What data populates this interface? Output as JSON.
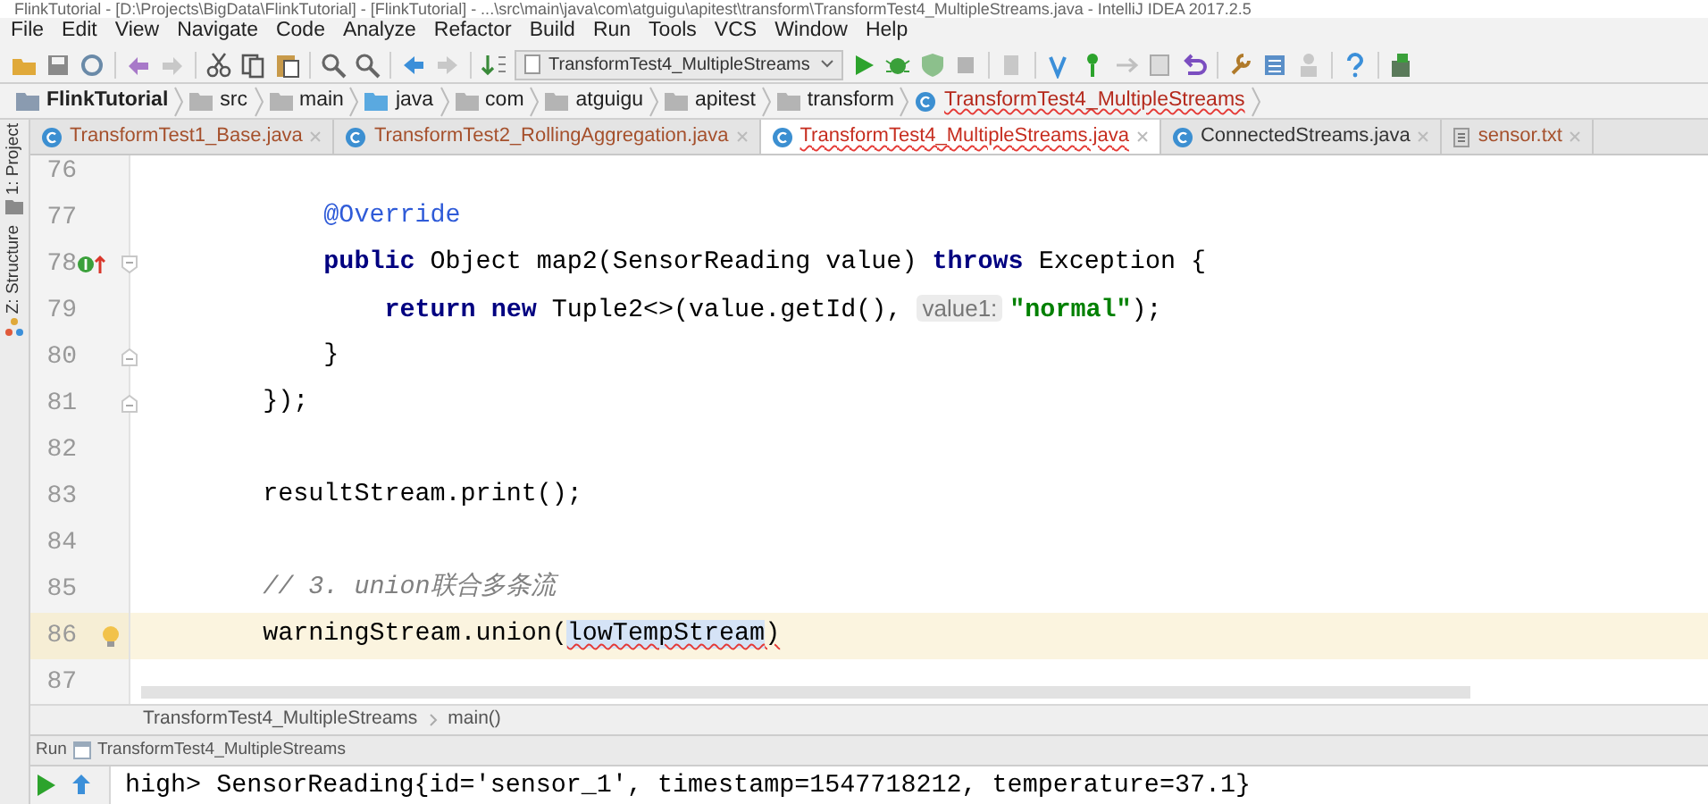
{
  "window": {
    "title": "FlinkTutorial - [D:\\Projects\\BigData\\FlinkTutorial] - [FlinkTutorial] - ...\\src\\main\\java\\com\\atguigu\\apitest\\transform\\TransformTest4_MultipleStreams.java - IntelliJ IDEA 2017.2.5"
  },
  "menu": [
    "File",
    "Edit",
    "View",
    "Navigate",
    "Code",
    "Analyze",
    "Refactor",
    "Build",
    "Run",
    "Tools",
    "VCS",
    "Window",
    "Help"
  ],
  "toolbar": {
    "run_configuration": "TransformTest4_MultipleStreams"
  },
  "breadcrumb": [
    {
      "label": "FlinkTutorial",
      "kind": "project"
    },
    {
      "label": "src",
      "kind": "folder"
    },
    {
      "label": "main",
      "kind": "folder"
    },
    {
      "label": "java",
      "kind": "source"
    },
    {
      "label": "com",
      "kind": "folder"
    },
    {
      "label": "atguigu",
      "kind": "folder"
    },
    {
      "label": "apitest",
      "kind": "folder"
    },
    {
      "label": "transform",
      "kind": "folder"
    },
    {
      "label": "TransformTest4_MultipleStreams",
      "kind": "class_error"
    }
  ],
  "tool_windows": [
    "1: Project",
    "Z: Structure"
  ],
  "tabs": [
    {
      "label": "TransformTest1_Base.java",
      "kind": "class",
      "modified": true,
      "has_errors": false,
      "selected": false
    },
    {
      "label": "TransformTest2_RollingAggregation.java",
      "kind": "class",
      "modified": true,
      "has_errors": false,
      "selected": false
    },
    {
      "label": "TransformTest4_MultipleStreams.java",
      "kind": "class",
      "has_errors": true,
      "selected": true
    },
    {
      "label": "ConnectedStreams.java",
      "kind": "class",
      "modified": false,
      "has_errors": false,
      "selected": false
    },
    {
      "label": "sensor.txt",
      "kind": "text",
      "modified": true,
      "has_errors": false,
      "selected": false
    }
  ],
  "editor": {
    "lines": [
      {
        "number": "76",
        "current": false
      },
      {
        "number": "77",
        "current": false,
        "tokens": [
          {
            "kind": "annotation",
            "text": "            @Override"
          }
        ]
      },
      {
        "number": "78",
        "current": false,
        "implements_marker": true,
        "fold_start": true,
        "tokens": [
          {
            "kind": "keyword",
            "text": "            public"
          },
          {
            "kind": "plain",
            "text": " Object map2(SensorReading value) "
          },
          {
            "kind": "keyword",
            "text": "throws"
          },
          {
            "kind": "plain",
            "text": " Exception {"
          }
        ]
      },
      {
        "number": "79",
        "current": false,
        "tokens": [
          {
            "kind": "keyword",
            "text": "                return new"
          },
          {
            "kind": "plain",
            "text": " Tuple2<>(value.getId(), "
          },
          {
            "kind": "hint",
            "text": "value1:"
          },
          {
            "kind": "string",
            "text": "\"normal\""
          },
          {
            "kind": "plain",
            "text": ");"
          }
        ]
      },
      {
        "number": "80",
        "current": false,
        "fold_end": true,
        "tokens": [
          {
            "kind": "plain",
            "text": "            }"
          }
        ]
      },
      {
        "number": "81",
        "current": false,
        "fold_end": true,
        "tokens": [
          {
            "kind": "plain",
            "text": "        });"
          }
        ]
      },
      {
        "number": "82",
        "current": false
      },
      {
        "number": "83",
        "current": false,
        "tokens": [
          {
            "kind": "plain",
            "text": "        resultStream.print();"
          }
        ]
      },
      {
        "number": "84",
        "current": false
      },
      {
        "number": "85",
        "current": false,
        "tokens": [
          {
            "kind": "comment",
            "text": "        // 3. union联合多条流"
          }
        ]
      },
      {
        "number": "86",
        "current": true,
        "intention_bulb": true,
        "tokens": [
          {
            "kind": "plain",
            "text": "        warningStream.union("
          },
          {
            "kind": "selection_error",
            "text": "lowTempStream"
          },
          {
            "kind": "error",
            "text": ")"
          }
        ]
      },
      {
        "number": "87",
        "current": false
      }
    ]
  },
  "navigation": [
    "TransformTest4_MultipleStreams",
    "main()"
  ],
  "run_panel": {
    "label": "Run",
    "tab": "TransformTest4_MultipleStreams",
    "output": [
      "high> SensorReading{id='sensor_1', timestamp=1547718212, temperature=37.1}"
    ]
  }
}
